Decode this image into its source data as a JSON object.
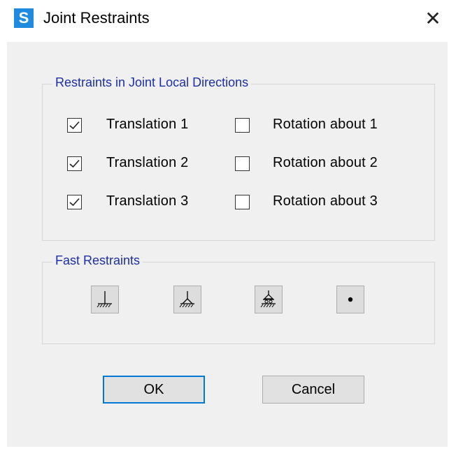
{
  "window": {
    "app_icon_letter": "S",
    "title": "Joint Restraints",
    "close_glyph": "✕"
  },
  "restraints_group": {
    "label": "Restraints in Joint Local Directions",
    "translations": [
      {
        "label": "Translation  1",
        "checked": true
      },
      {
        "label": "Translation  2",
        "checked": true
      },
      {
        "label": "Translation  3",
        "checked": true
      }
    ],
    "rotations": [
      {
        "label": "Rotation about  1",
        "checked": false
      },
      {
        "label": "Rotation about  2",
        "checked": false
      },
      {
        "label": "Rotation about  3",
        "checked": false
      }
    ]
  },
  "fast_group": {
    "label": "Fast Restraints",
    "buttons": [
      {
        "icon": "fixed-support-icon"
      },
      {
        "icon": "pinned-support-icon"
      },
      {
        "icon": "roller-support-icon"
      },
      {
        "icon": "free-joint-icon"
      }
    ]
  },
  "buttons": {
    "ok": "OK",
    "cancel": "Cancel"
  },
  "colors": {
    "accent": "#0078d7",
    "group_label": "#1c2fa8",
    "app_icon": "#1f8be0",
    "dialog_bg": "#f0f0f0"
  }
}
